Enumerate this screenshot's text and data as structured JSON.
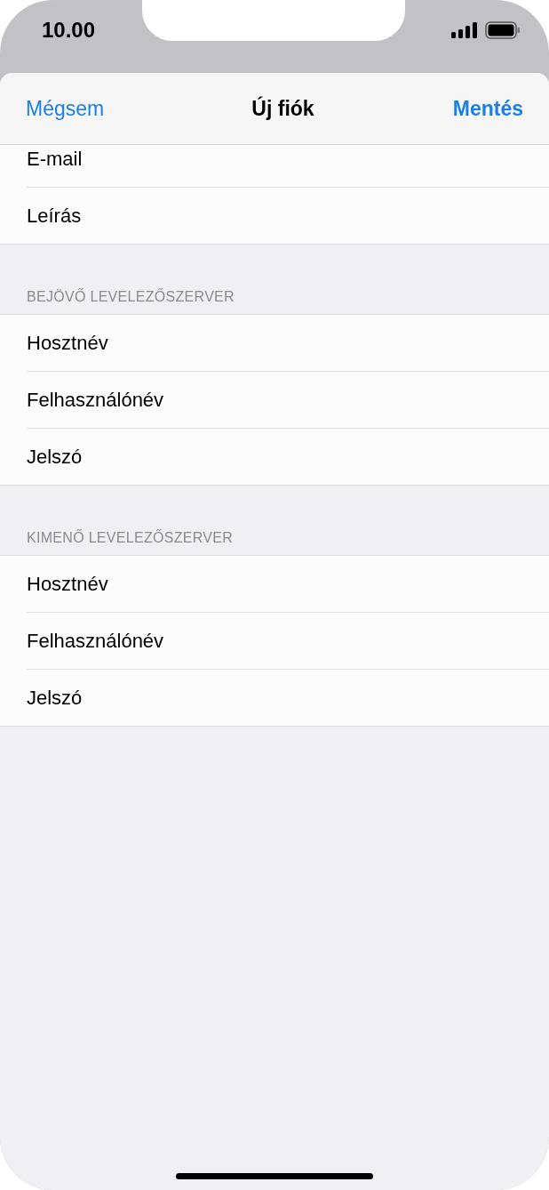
{
  "status_bar": {
    "time": "10.00"
  },
  "nav": {
    "cancel": "Mégsem",
    "title": "Új fiók",
    "save": "Mentés"
  },
  "sections": [
    {
      "rows": [
        {
          "label": "E-mail"
        },
        {
          "label": "Leírás"
        }
      ]
    },
    {
      "header": "BEJÖVŐ LEVELEZŐSZERVER",
      "rows": [
        {
          "label": "Hosztnév"
        },
        {
          "label": "Felhasználónév"
        },
        {
          "label": "Jelszó"
        }
      ]
    },
    {
      "header": "KIMENŐ LEVELEZŐSZERVER",
      "rows": [
        {
          "label": "Hosztnév"
        },
        {
          "label": "Felhasználónév"
        },
        {
          "label": "Jelszó"
        }
      ]
    }
  ]
}
